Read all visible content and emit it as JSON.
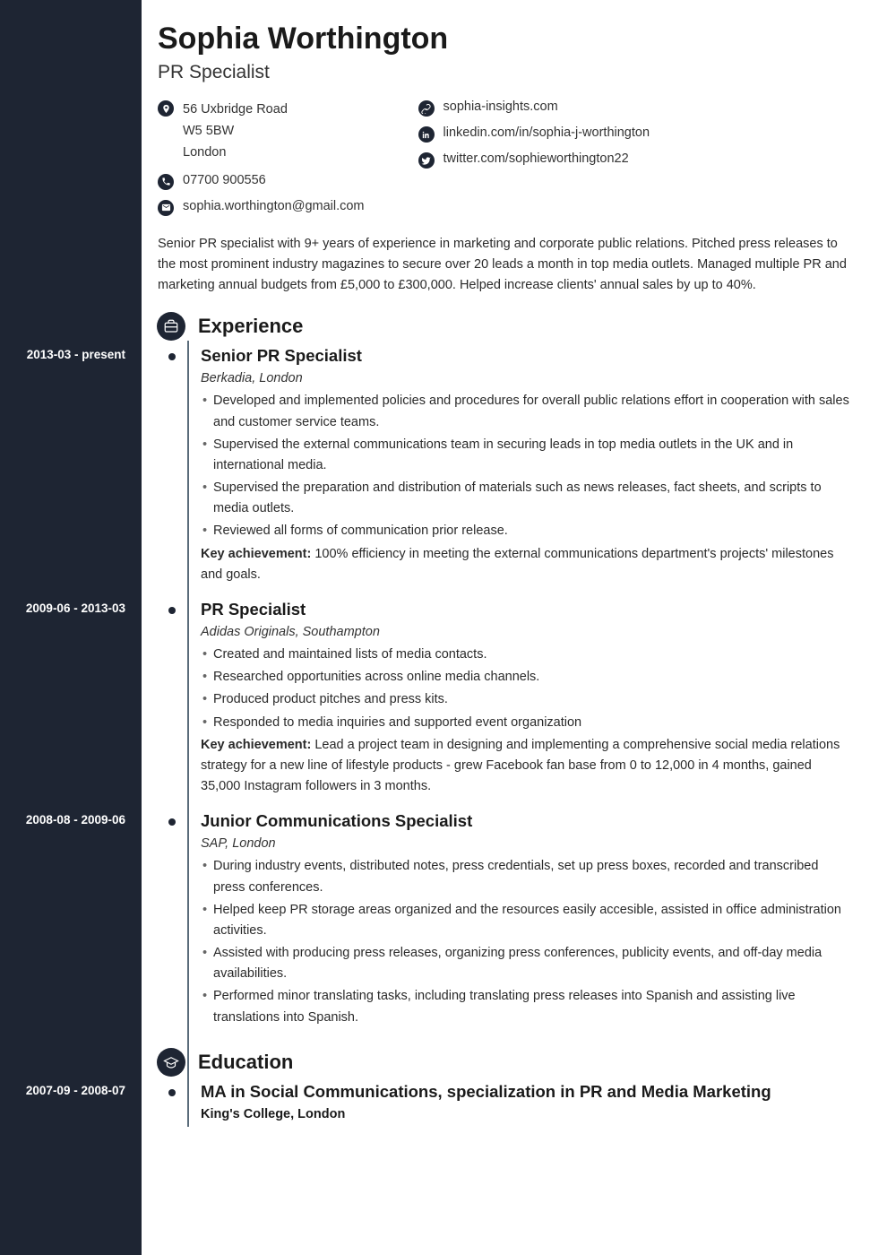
{
  "name": "Sophia Worthington",
  "title": "PR Specialist",
  "contacts": {
    "address": {
      "line1": "56 Uxbridge Road",
      "line2": "W5 5BW",
      "line3": "London"
    },
    "phone": "07700 900556",
    "email": "sophia.worthington@gmail.com",
    "website": "sophia-insights.com",
    "linkedin": "linkedin.com/in/sophia-j-worthington",
    "twitter": "twitter.com/sophieworthington22"
  },
  "summary": "Senior PR specialist with 9+ years of experience in marketing and corporate public relations. Pitched press releases to the most prominent industry magazines to secure over 20 leads a month in top media outlets. Managed multiple PR and marketing annual budgets from £5,000 to £300,000. Helped increase clients' annual sales by up to 40%.",
  "sections": {
    "experience_title": "Experience",
    "education_title": "Education"
  },
  "experience": [
    {
      "dates": "2013-03 - present",
      "title": "Senior PR Specialist",
      "company": "Berkadia, London",
      "bullets": [
        "Developed and implemented policies and procedures for overall public relations effort in cooperation with sales and customer service teams.",
        "Supervised the external communications team in securing leads in top media outlets in the UK and in international media.",
        "Supervised the preparation and distribution of materials such as news releases, fact sheets, and scripts to media outlets.",
        "Reviewed all forms of communication prior release."
      ],
      "achievement_label": "Key achievement:",
      "achievement": "100% efficiency in meeting the external communications department's projects' milestones and goals."
    },
    {
      "dates": "2009-06 - 2013-03",
      "title": "PR Specialist",
      "company": "Adidas Originals, Southampton",
      "bullets": [
        "Created and maintained lists of media contacts.",
        "Researched opportunities across online media channels.",
        "Produced product pitches and press kits.",
        "Responded to media inquiries and supported event organization"
      ],
      "achievement_label": "Key achievement:",
      "achievement": "Lead a project team in designing and implementing a comprehensive social media relations strategy for a new line of lifestyle products - grew Facebook fan base from 0 to 12,000 in 4 months, gained 35,000 Instagram followers in 3 months."
    },
    {
      "dates": "2008-08 - 2009-06",
      "title": "Junior Communications Specialist",
      "company": "SAP, London",
      "bullets": [
        "During industry events, distributed notes, press credentials, set up press boxes, recorded and transcribed press conferences.",
        "Helped keep PR storage areas organized and the resources easily accesible, assisted in office administration activities.",
        "Assisted with producing press releases, organizing press conferences, publicity events, and off-day media availabilities.",
        "Performed minor translating tasks, including translating press releases into Spanish and assisting live translations into Spanish."
      ]
    }
  ],
  "education": [
    {
      "dates": "2007-09 - 2008-07",
      "title": "MA in Social Communications, specialization in PR and Media Marketing",
      "school": "King's College, London"
    }
  ]
}
